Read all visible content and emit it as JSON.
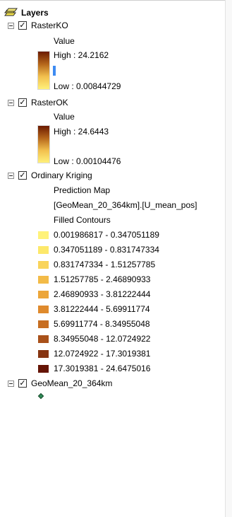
{
  "toc": {
    "root_label": "Layers",
    "layers": [
      {
        "name": "RasterKO",
        "checked": true,
        "field": "Value",
        "high": "High : 24.2162",
        "low": "Low : 0.00844729",
        "ramp_colors": [
          "#6b1a00",
          "#b5661b",
          "#f2c04e",
          "#fff07a"
        ],
        "marker_color": "#3d8bf2"
      },
      {
        "name": "RasterOK",
        "checked": true,
        "field": "Value",
        "high": "High : 24.6443",
        "low": "Low : 0.00104476",
        "ramp_colors": [
          "#6b1a00",
          "#b5661b",
          "#f2c04e",
          "#fff07a"
        ]
      },
      {
        "name": "Ordinary Kriging",
        "checked": true,
        "prediction_map": "Prediction Map",
        "field_expr": "[GeoMean_20_364km].[U_mean_pos]",
        "filled_contours": "Filled Contours",
        "classes": [
          {
            "label": "0.001986817 - 0.347051189",
            "color": "#fff27a"
          },
          {
            "label": "0.347051189 - 0.831747334",
            "color": "#fde86a"
          },
          {
            "label": "0.831747334 - 1.51257785",
            "color": "#f9d45b"
          },
          {
            "label": "1.51257785 - 2.46890933",
            "color": "#f3bb48"
          },
          {
            "label": "2.46890933 - 3.81222444",
            "color": "#eca63a"
          },
          {
            "label": "3.81222444 - 5.69911774",
            "color": "#df8a2d"
          },
          {
            "label": "5.69911774 - 8.34955048",
            "color": "#c76e22"
          },
          {
            "label": "8.34955048 - 12.0724922",
            "color": "#a9511a"
          },
          {
            "label": "12.0724922 - 17.3019381",
            "color": "#873512"
          },
          {
            "label": "17.3019381 - 24.6475016",
            "color": "#651405"
          }
        ]
      },
      {
        "name": "GeoMean_20_364km",
        "checked": true,
        "symbol_color": "#2e8b57"
      }
    ]
  }
}
